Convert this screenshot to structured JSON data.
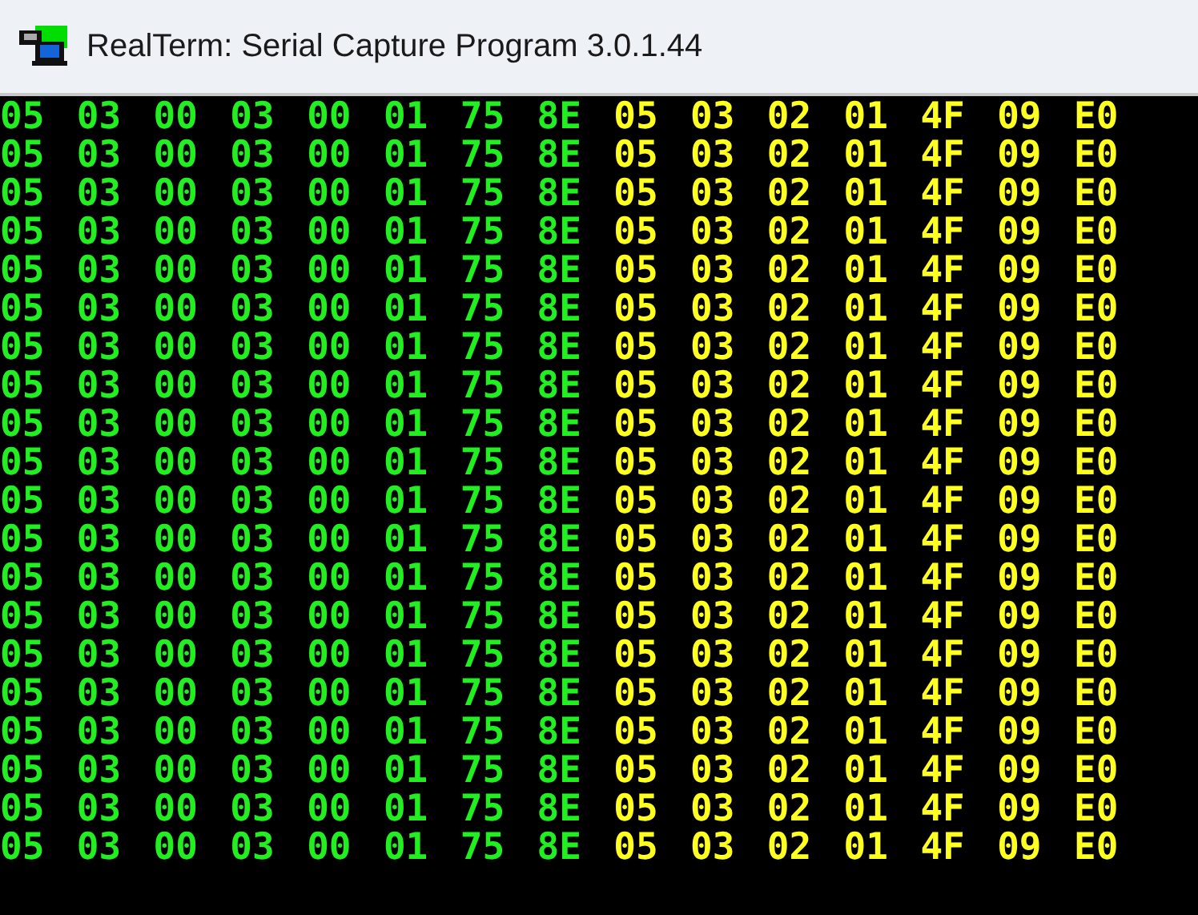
{
  "window": {
    "title": "RealTerm: Serial Capture Program 3.0.1.44"
  },
  "terminal": {
    "rows": [
      {
        "sent": [
          "05",
          "03",
          "00",
          "03",
          "00",
          "01",
          "75",
          "8E"
        ],
        "received": [
          "05",
          "03",
          "02",
          "01",
          "4F",
          "09",
          "E0"
        ]
      },
      {
        "sent": [
          "05",
          "03",
          "00",
          "03",
          "00",
          "01",
          "75",
          "8E"
        ],
        "received": [
          "05",
          "03",
          "02",
          "01",
          "4F",
          "09",
          "E0"
        ]
      },
      {
        "sent": [
          "05",
          "03",
          "00",
          "03",
          "00",
          "01",
          "75",
          "8E"
        ],
        "received": [
          "05",
          "03",
          "02",
          "01",
          "4F",
          "09",
          "E0"
        ]
      },
      {
        "sent": [
          "05",
          "03",
          "00",
          "03",
          "00",
          "01",
          "75",
          "8E"
        ],
        "received": [
          "05",
          "03",
          "02",
          "01",
          "4F",
          "09",
          "E0"
        ]
      },
      {
        "sent": [
          "05",
          "03",
          "00",
          "03",
          "00",
          "01",
          "75",
          "8E"
        ],
        "received": [
          "05",
          "03",
          "02",
          "01",
          "4F",
          "09",
          "E0"
        ]
      },
      {
        "sent": [
          "05",
          "03",
          "00",
          "03",
          "00",
          "01",
          "75",
          "8E"
        ],
        "received": [
          "05",
          "03",
          "02",
          "01",
          "4F",
          "09",
          "E0"
        ]
      },
      {
        "sent": [
          "05",
          "03",
          "00",
          "03",
          "00",
          "01",
          "75",
          "8E"
        ],
        "received": [
          "05",
          "03",
          "02",
          "01",
          "4F",
          "09",
          "E0"
        ]
      },
      {
        "sent": [
          "05",
          "03",
          "00",
          "03",
          "00",
          "01",
          "75",
          "8E"
        ],
        "received": [
          "05",
          "03",
          "02",
          "01",
          "4F",
          "09",
          "E0"
        ]
      },
      {
        "sent": [
          "05",
          "03",
          "00",
          "03",
          "00",
          "01",
          "75",
          "8E"
        ],
        "received": [
          "05",
          "03",
          "02",
          "01",
          "4F",
          "09",
          "E0"
        ]
      },
      {
        "sent": [
          "05",
          "03",
          "00",
          "03",
          "00",
          "01",
          "75",
          "8E"
        ],
        "received": [
          "05",
          "03",
          "02",
          "01",
          "4F",
          "09",
          "E0"
        ]
      },
      {
        "sent": [
          "05",
          "03",
          "00",
          "03",
          "00",
          "01",
          "75",
          "8E"
        ],
        "received": [
          "05",
          "03",
          "02",
          "01",
          "4F",
          "09",
          "E0"
        ]
      },
      {
        "sent": [
          "05",
          "03",
          "00",
          "03",
          "00",
          "01",
          "75",
          "8E"
        ],
        "received": [
          "05",
          "03",
          "02",
          "01",
          "4F",
          "09",
          "E0"
        ]
      },
      {
        "sent": [
          "05",
          "03",
          "00",
          "03",
          "00",
          "01",
          "75",
          "8E"
        ],
        "received": [
          "05",
          "03",
          "02",
          "01",
          "4F",
          "09",
          "E0"
        ]
      },
      {
        "sent": [
          "05",
          "03",
          "00",
          "03",
          "00",
          "01",
          "75",
          "8E"
        ],
        "received": [
          "05",
          "03",
          "02",
          "01",
          "4F",
          "09",
          "E0"
        ]
      },
      {
        "sent": [
          "05",
          "03",
          "00",
          "03",
          "00",
          "01",
          "75",
          "8E"
        ],
        "received": [
          "05",
          "03",
          "02",
          "01",
          "4F",
          "09",
          "E0"
        ]
      },
      {
        "sent": [
          "05",
          "03",
          "00",
          "03",
          "00",
          "01",
          "75",
          "8E"
        ],
        "received": [
          "05",
          "03",
          "02",
          "01",
          "4F",
          "09",
          "E0"
        ]
      },
      {
        "sent": [
          "05",
          "03",
          "00",
          "03",
          "00",
          "01",
          "75",
          "8E"
        ],
        "received": [
          "05",
          "03",
          "02",
          "01",
          "4F",
          "09",
          "E0"
        ]
      },
      {
        "sent": [
          "05",
          "03",
          "00",
          "03",
          "00",
          "01",
          "75",
          "8E"
        ],
        "received": [
          "05",
          "03",
          "02",
          "01",
          "4F",
          "09",
          "E0"
        ]
      },
      {
        "sent": [
          "05",
          "03",
          "00",
          "03",
          "00",
          "01",
          "75",
          "8E"
        ],
        "received": [
          "05",
          "03",
          "02",
          "01",
          "4F",
          "09",
          "E0"
        ]
      },
      {
        "sent": [
          "05",
          "03",
          "00",
          "03",
          "00",
          "01",
          "75",
          "8E"
        ],
        "received": [
          "05",
          "03",
          "02",
          "01",
          "4F",
          "09",
          "E0"
        ]
      }
    ]
  }
}
